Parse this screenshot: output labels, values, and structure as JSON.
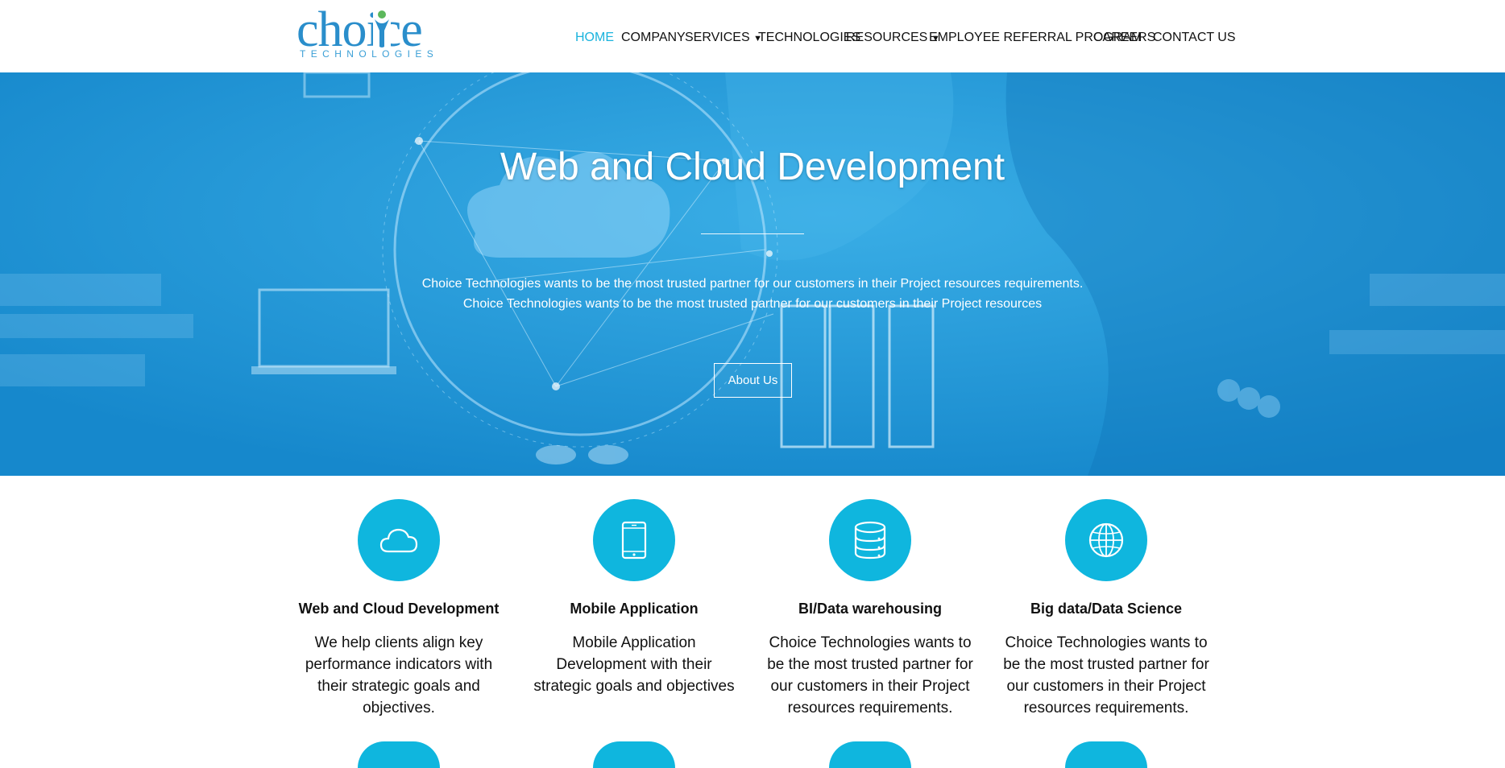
{
  "brand": {
    "logo_word": "choice",
    "logo_sub": "TECHNOLOGIES"
  },
  "nav": {
    "items": [
      {
        "label": "HOME",
        "active": true
      },
      {
        "label": "COMPANY"
      },
      {
        "label": "SERVICES",
        "caret": "▼"
      },
      {
        "label": "TECHNOLOGIES"
      },
      {
        "label": "RESOURCES",
        "caret": "▼"
      },
      {
        "label": "EMPLOYEE REFERRAL PROGRAM"
      },
      {
        "label": "CAREERS"
      },
      {
        "label": "CONTACT US"
      }
    ]
  },
  "hero": {
    "title": "Web and Cloud Development",
    "line1": "Choice Technologies wants to be the most trusted partner for our customers in their Project resources requirements.",
    "line2": "Choice Technologies wants to be the most trusted partner for our customers in their Project resources",
    "button": "About Us"
  },
  "features": [
    {
      "icon": "cloud-icon",
      "title": "Web and Cloud Development",
      "text": "We help clients align key performance indicators with their strategic goals and objectives."
    },
    {
      "icon": "tablet-icon",
      "title": "Mobile Application",
      "text": "Mobile Application Development with their strategic goals and objectives"
    },
    {
      "icon": "database-icon",
      "title": "BI/Data warehousing",
      "text": "Choice Technologies wants to be the most trusted partner for our customers in their Project resources requirements."
    },
    {
      "icon": "globe-icon",
      "title": "Big data/Data Science",
      "text": "Choice Technologies wants to be the most trusted partner for our customers in their Project resources requirements."
    }
  ],
  "colors": {
    "accent": "#0fb6de",
    "hero": "#1b97d8",
    "nav_active": "#1ab3dd"
  }
}
